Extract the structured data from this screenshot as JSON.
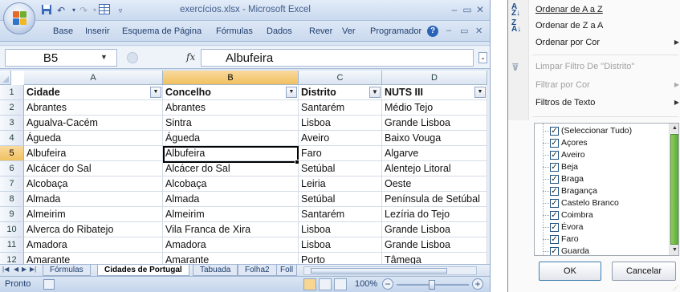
{
  "window": {
    "title": "exercícios.xlsx - Microsoft Excel",
    "controls": {
      "minimize": "–",
      "restore": "▭",
      "close": "✕"
    }
  },
  "quick_access": {
    "save_icon": "save-icon",
    "undo_icon": "undo-icon",
    "redo_icon": "redo-icon",
    "custom_icon": "table-icon"
  },
  "ribbon": {
    "tabs": [
      "Base",
      "Inserir",
      "Esquema de Página",
      "Fórmulas",
      "Dados",
      "Rever",
      "Ver",
      "Programador"
    ],
    "help": "?"
  },
  "formula_bar": {
    "name_box": "B5",
    "fx": "fx",
    "value": "Albufeira"
  },
  "grid": {
    "columns": [
      "A",
      "B",
      "C",
      "D"
    ],
    "active_column": "B",
    "active_row": "5",
    "header_row": [
      "Cidade",
      "Concelho",
      "Distrito",
      "NUTS III"
    ],
    "filter_active_column": "Distrito",
    "row_numbers": [
      "1",
      "2",
      "3",
      "4",
      "5",
      "6",
      "7",
      "8",
      "9",
      "10",
      "11",
      "12"
    ],
    "rows": [
      [
        "Abrantes",
        "Abrantes",
        "Santarém",
        "Médio Tejo"
      ],
      [
        "Agualva-Cacém",
        "Sintra",
        "Lisboa",
        "Grande Lisboa"
      ],
      [
        "Águeda",
        "Águeda",
        "Aveiro",
        "Baixo Vouga"
      ],
      [
        "Albufeira",
        "Albufeira",
        "Faro",
        "Algarve"
      ],
      [
        "Alcácer do Sal",
        "Alcácer do Sal",
        "Setúbal",
        "Alentejo Litoral"
      ],
      [
        "Alcobaça",
        "Alcobaça",
        "Leiria",
        "Oeste"
      ],
      [
        "Almada",
        "Almada",
        "Setúbal",
        "Península de Setúbal"
      ],
      [
        "Almeirim",
        "Almeirim",
        "Santarém",
        "Lezíria do Tejo"
      ],
      [
        "Alverca do Ribatejo",
        "Vila Franca de Xira",
        "Lisboa",
        "Grande Lisboa"
      ],
      [
        "Amadora",
        "Amadora",
        "Lisboa",
        "Grande Lisboa"
      ],
      [
        "Amarante",
        "Amarante",
        "Porto",
        "Tâmega"
      ]
    ]
  },
  "sheets": {
    "tabs": [
      "Fórmulas",
      "Cidades de Portugal",
      "Tabuada",
      "Folha2",
      "Foll"
    ],
    "active": "Cidades de Portugal"
  },
  "status": {
    "text": "Pronto",
    "zoom": "100%",
    "zoom_level_percent": 100
  },
  "filter_menu": {
    "sort_asc": "Ordenar de A a Z",
    "sort_desc": "Ordenar de Z a A",
    "sort_color": "Ordenar por Cor",
    "clear_filter": "Limpar Filtro De \"Distrito\"",
    "filter_color": "Filtrar por Cor",
    "text_filters": "Filtros de Texto",
    "values": [
      "(Seleccionar Tudo)",
      "Açores",
      "Aveiro",
      "Beja",
      "Braga",
      "Bragança",
      "Castelo Branco",
      "Coimbra",
      "Évora",
      "Faro",
      "Guarda"
    ],
    "checked_mark": "✓",
    "ok": "OK",
    "cancel": "Cancelar"
  }
}
